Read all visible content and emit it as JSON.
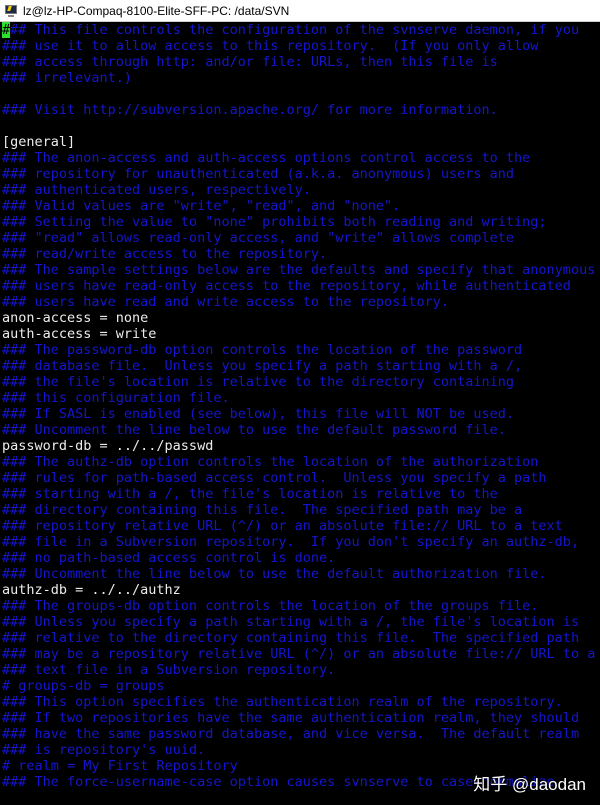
{
  "window": {
    "title": "lz@lz-HP-Compaq-8100-Elite-SFF-PC: /data/SVN",
    "icon": "putty-terminal-icon"
  },
  "colors": {
    "background": "#000000",
    "comment": "#1515cf",
    "config_text": "#ececec",
    "cursor": "#2ee02e"
  },
  "terminal": {
    "cursor_char": "#",
    "lines": [
      {
        "text": "## This file controls the configuration of the svnserve daemon, if you",
        "type": "comment"
      },
      {
        "text": "### use it to allow access to this repository.  (If you only allow",
        "type": "comment"
      },
      {
        "text": "### access through http: and/or file: URLs, then this file is",
        "type": "comment"
      },
      {
        "text": "### irrelevant.)",
        "type": "comment"
      },
      {
        "text": "",
        "type": "comment"
      },
      {
        "text": "### Visit http://subversion.apache.org/ for more information.",
        "type": "comment"
      },
      {
        "text": "",
        "type": "comment"
      },
      {
        "text": "[general]",
        "type": "config"
      },
      {
        "text": "### The anon-access and auth-access options control access to the",
        "type": "comment"
      },
      {
        "text": "### repository for unauthenticated (a.k.a. anonymous) users and",
        "type": "comment"
      },
      {
        "text": "### authenticated users, respectively.",
        "type": "comment"
      },
      {
        "text": "### Valid values are \"write\", \"read\", and \"none\".",
        "type": "comment"
      },
      {
        "text": "### Setting the value to \"none\" prohibits both reading and writing;",
        "type": "comment"
      },
      {
        "text": "### \"read\" allows read-only access, and \"write\" allows complete",
        "type": "comment"
      },
      {
        "text": "### read/write access to the repository.",
        "type": "comment"
      },
      {
        "text": "### The sample settings below are the defaults and specify that anonymous",
        "type": "comment"
      },
      {
        "text": "### users have read-only access to the repository, while authenticated",
        "type": "comment"
      },
      {
        "text": "### users have read and write access to the repository.",
        "type": "comment"
      },
      {
        "text": "anon-access = none",
        "type": "config"
      },
      {
        "text": "auth-access = write",
        "type": "config"
      },
      {
        "text": "### The password-db option controls the location of the password",
        "type": "comment"
      },
      {
        "text": "### database file.  Unless you specify a path starting with a /,",
        "type": "comment"
      },
      {
        "text": "### the file's location is relative to the directory containing",
        "type": "comment"
      },
      {
        "text": "### this configuration file.",
        "type": "comment"
      },
      {
        "text": "### If SASL is enabled (see below), this file will NOT be used.",
        "type": "comment"
      },
      {
        "text": "### Uncomment the line below to use the default password file.",
        "type": "comment"
      },
      {
        "text": "password-db = ../../passwd",
        "type": "config"
      },
      {
        "text": "### The authz-db option controls the location of the authorization",
        "type": "comment"
      },
      {
        "text": "### rules for path-based access control.  Unless you specify a path",
        "type": "comment"
      },
      {
        "text": "### starting with a /, the file's location is relative to the",
        "type": "comment"
      },
      {
        "text": "### directory containing this file.  The specified path may be a",
        "type": "comment"
      },
      {
        "text": "### repository relative URL (^/) or an absolute file:// URL to a text",
        "type": "comment"
      },
      {
        "text": "### file in a Subversion repository.  If you don't specify an authz-db,",
        "type": "comment"
      },
      {
        "text": "### no path-based access control is done.",
        "type": "comment"
      },
      {
        "text": "### Uncomment the line below to use the default authorization file.",
        "type": "comment"
      },
      {
        "text": "authz-db = ../../authz",
        "type": "config"
      },
      {
        "text": "### The groups-db option controls the location of the groups file.",
        "type": "comment"
      },
      {
        "text": "### Unless you specify a path starting with a /, the file's location is",
        "type": "comment"
      },
      {
        "text": "### relative to the directory containing this file.  The specified path",
        "type": "comment"
      },
      {
        "text": "### may be a repository relative URL (^/) or an absolute file:// URL to a",
        "type": "comment"
      },
      {
        "text": "### text file in a Subversion repository.",
        "type": "comment"
      },
      {
        "text": "# groups-db = groups",
        "type": "comment"
      },
      {
        "text": "### This option specifies the authentication realm of the repository.",
        "type": "comment"
      },
      {
        "text": "### If two repositories have the same authentication realm, they should",
        "type": "comment"
      },
      {
        "text": "### have the same password database, and vice versa.  The default realm",
        "type": "comment"
      },
      {
        "text": "### is repository's uuid.",
        "type": "comment"
      },
      {
        "text": "# realm = My First Repository",
        "type": "comment"
      },
      {
        "text": "### The force-username-case option causes svnserve to case-normalize",
        "type": "comment"
      }
    ]
  },
  "watermark": "知乎 @daodan"
}
